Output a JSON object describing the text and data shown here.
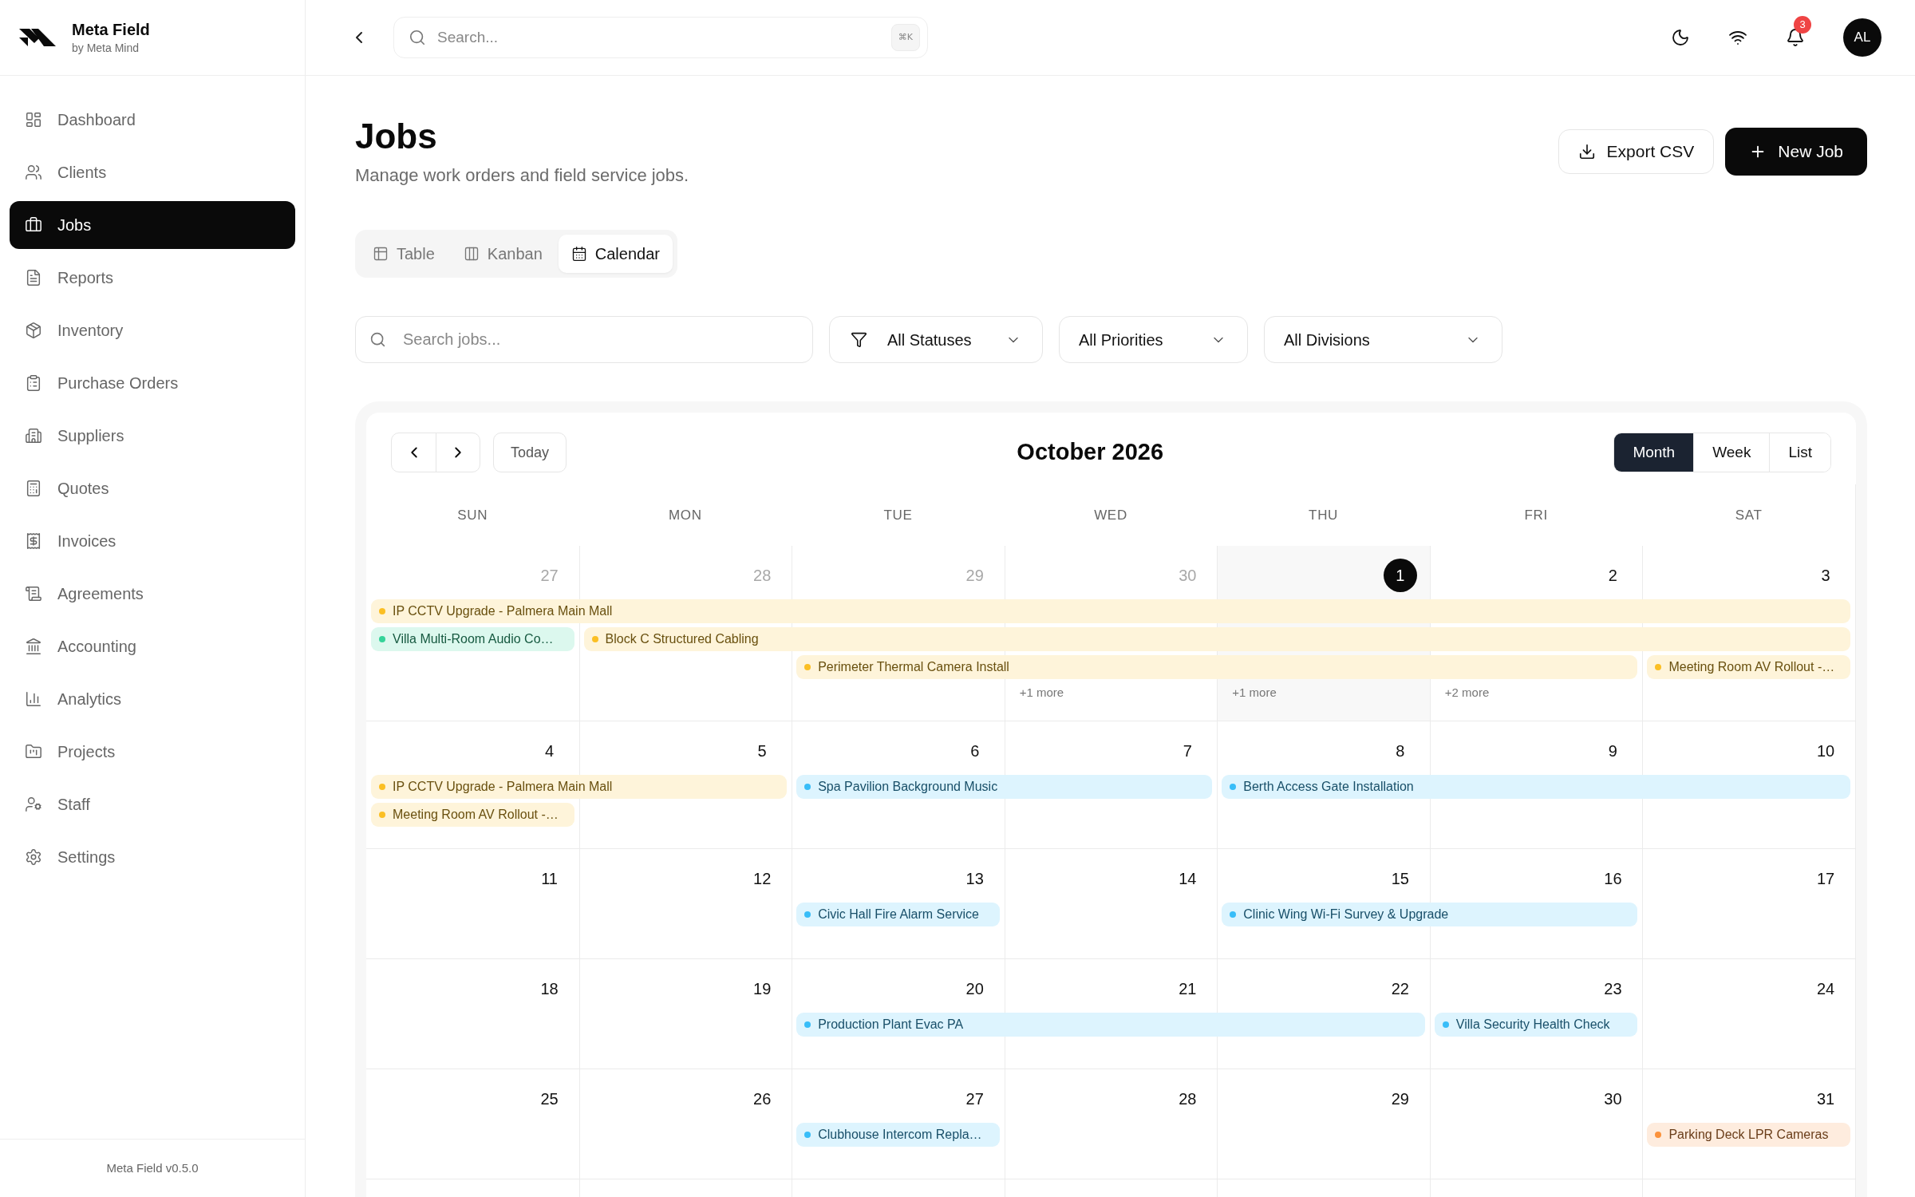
{
  "sidebar": {
    "brand": {
      "name": "Meta Field",
      "tagline": "by Meta Mind"
    },
    "items": [
      {
        "label": "Dashboard",
        "selected": false
      },
      {
        "label": "Clients",
        "selected": false
      },
      {
        "label": "Jobs",
        "selected": true
      },
      {
        "label": "Reports",
        "selected": false
      },
      {
        "label": "Inventory",
        "selected": false
      },
      {
        "label": "Purchase Orders",
        "selected": false
      },
      {
        "label": "Suppliers",
        "selected": false
      },
      {
        "label": "Quotes",
        "selected": false
      },
      {
        "label": "Invoices",
        "selected": false
      },
      {
        "label": "Agreements",
        "selected": false
      },
      {
        "label": "Accounting",
        "selected": false
      },
      {
        "label": "Analytics",
        "selected": false
      },
      {
        "label": "Projects",
        "selected": false
      },
      {
        "label": "Staff",
        "selected": false
      },
      {
        "label": "Settings",
        "selected": false
      }
    ],
    "footer": "Meta Field v0.5.0"
  },
  "topbar": {
    "search": {
      "placeholder": "Search...",
      "shortcut": "⌘K"
    },
    "notifications": {
      "count": "3"
    },
    "avatar": {
      "initials": "AL"
    }
  },
  "page": {
    "title": "Jobs",
    "subtitle": "Manage work orders and field service jobs.",
    "actions": [
      {
        "label": "Export CSV",
        "kind": "outline"
      },
      {
        "label": "New Job",
        "kind": "primary"
      }
    ]
  },
  "view_tabs": [
    {
      "label": "Table",
      "selected": false
    },
    {
      "label": "Kanban",
      "selected": false
    },
    {
      "label": "Calendar",
      "selected": true
    }
  ],
  "filters": {
    "search": {
      "placeholder": "Search jobs..."
    },
    "dropdowns": [
      {
        "value": "All Statuses",
        "kind": "filter"
      },
      {
        "value": "All Priorities",
        "kind": "select"
      },
      {
        "value": "All Divisions",
        "kind": "select"
      }
    ]
  },
  "calendar": {
    "title": "October 2026",
    "today_button": "Today",
    "views": [
      {
        "label": "Month",
        "selected": true
      },
      {
        "label": "Week",
        "selected": false
      },
      {
        "label": "List",
        "selected": false
      }
    ],
    "weekdays": [
      "SUN",
      "MON",
      "TUE",
      "WED",
      "THU",
      "FRI",
      "SAT"
    ],
    "weeks": [
      {
        "days": [
          {
            "day": "27",
            "in_month": false,
            "today": false
          },
          {
            "day": "28",
            "in_month": false,
            "today": false
          },
          {
            "day": "29",
            "in_month": false,
            "today": false
          },
          {
            "day": "30",
            "in_month": false,
            "today": false,
            "more": "+1 more"
          },
          {
            "day": "1",
            "in_month": true,
            "today": true,
            "more": "+1 more"
          },
          {
            "day": "2",
            "in_month": true,
            "today": false,
            "more": "+2 more"
          },
          {
            "day": "3",
            "in_month": true,
            "today": false
          }
        ],
        "lanes": [
          [
            {
              "kind": "event",
              "title": "IP CCTV Upgrade - Palmera Main Mall",
              "color": "#fbbf24"
            },
            {
              "kind": "continued"
            },
            {
              "kind": "continued"
            },
            {
              "kind": "continued"
            },
            {
              "kind": "continued"
            },
            {
              "kind": "continued"
            },
            {
              "kind": "continued"
            }
          ],
          [
            {
              "kind": "event",
              "title": "Villa Multi-Room Audio Co…",
              "color": "#34d399"
            },
            {
              "kind": "event",
              "title": "Block C Structured Cabling",
              "color": "#fbbf24"
            },
            {
              "kind": "continued"
            },
            {
              "kind": "continued"
            },
            {
              "kind": "continued"
            },
            {
              "kind": "continued"
            },
            {
              "kind": "continued"
            }
          ],
          [
            {
              "kind": "free"
            },
            {
              "kind": "free"
            },
            {
              "kind": "event",
              "title": "Perimeter Thermal Camera Install",
              "color": "#fbbf24"
            },
            {
              "kind": "continued"
            },
            {
              "kind": "continued"
            },
            {
              "kind": "continued"
            },
            {
              "kind": "event",
              "title": "Meeting Room AV Rollout -…",
              "color": "#fbbf24"
            }
          ]
        ]
      },
      {
        "days": [
          {
            "day": "4",
            "in_month": true,
            "today": false
          },
          {
            "day": "5",
            "in_month": true,
            "today": false
          },
          {
            "day": "6",
            "in_month": true,
            "today": false
          },
          {
            "day": "7",
            "in_month": true,
            "today": false
          },
          {
            "day": "8",
            "in_month": true,
            "today": false
          },
          {
            "day": "9",
            "in_month": true,
            "today": false
          },
          {
            "day": "10",
            "in_month": true,
            "today": false
          }
        ],
        "lanes": [
          [
            {
              "kind": "event",
              "title": "IP CCTV Upgrade - Palmera Main Mall",
              "color": "#fbbf24"
            },
            {
              "kind": "continued"
            },
            {
              "kind": "event",
              "title": "Spa Pavilion Background Music",
              "color": "#38bdf8"
            },
            {
              "kind": "continued"
            },
            {
              "kind": "event",
              "title": "Berth Access Gate Installation",
              "color": "#38bdf8"
            },
            {
              "kind": "continued"
            },
            {
              "kind": "continued"
            }
          ],
          [
            {
              "kind": "event",
              "title": "Meeting Room AV Rollout -…",
              "color": "#fbbf24"
            },
            {
              "kind": "free"
            },
            {
              "kind": "free"
            },
            {
              "kind": "free"
            },
            {
              "kind": "free"
            },
            {
              "kind": "free"
            },
            {
              "kind": "free"
            }
          ]
        ]
      },
      {
        "days": [
          {
            "day": "11",
            "in_month": true,
            "today": false
          },
          {
            "day": "12",
            "in_month": true,
            "today": false
          },
          {
            "day": "13",
            "in_month": true,
            "today": false
          },
          {
            "day": "14",
            "in_month": true,
            "today": false
          },
          {
            "day": "15",
            "in_month": true,
            "today": false
          },
          {
            "day": "16",
            "in_month": true,
            "today": false
          },
          {
            "day": "17",
            "in_month": true,
            "today": false
          }
        ],
        "lanes": [
          [
            {
              "kind": "free"
            },
            {
              "kind": "free"
            },
            {
              "kind": "event",
              "title": "Civic Hall Fire Alarm Service",
              "color": "#38bdf8"
            },
            {
              "kind": "free"
            },
            {
              "kind": "event",
              "title": "Clinic Wing Wi-Fi Survey & Upgrade",
              "color": "#38bdf8"
            },
            {
              "kind": "continued"
            },
            {
              "kind": "free"
            }
          ]
        ]
      },
      {
        "days": [
          {
            "day": "18",
            "in_month": true,
            "today": false
          },
          {
            "day": "19",
            "in_month": true,
            "today": false
          },
          {
            "day": "20",
            "in_month": true,
            "today": false
          },
          {
            "day": "21",
            "in_month": true,
            "today": false
          },
          {
            "day": "22",
            "in_month": true,
            "today": false
          },
          {
            "day": "23",
            "in_month": true,
            "today": false
          },
          {
            "day": "24",
            "in_month": true,
            "today": false
          }
        ],
        "lanes": [
          [
            {
              "kind": "free"
            },
            {
              "kind": "free"
            },
            {
              "kind": "event",
              "title": "Production Plant Evac PA",
              "color": "#38bdf8"
            },
            {
              "kind": "continued"
            },
            {
              "kind": "continued"
            },
            {
              "kind": "event",
              "title": "Villa Security Health Check",
              "color": "#38bdf8"
            },
            {
              "kind": "free"
            }
          ]
        ]
      },
      {
        "days": [
          {
            "day": "25",
            "in_month": true,
            "today": false
          },
          {
            "day": "26",
            "in_month": true,
            "today": false
          },
          {
            "day": "27",
            "in_month": true,
            "today": false
          },
          {
            "day": "28",
            "in_month": true,
            "today": false
          },
          {
            "day": "29",
            "in_month": true,
            "today": false
          },
          {
            "day": "30",
            "in_month": true,
            "today": false
          },
          {
            "day": "31",
            "in_month": true,
            "today": false
          }
        ],
        "lanes": [
          [
            {
              "kind": "free"
            },
            {
              "kind": "free"
            },
            {
              "kind": "event",
              "title": "Clubhouse Intercom Repla…",
              "color": "#38bdf8"
            },
            {
              "kind": "free"
            },
            {
              "kind": "free"
            },
            {
              "kind": "free"
            },
            {
              "kind": "event",
              "title": "Parking Deck LPR Cameras",
              "color": "#fb923c"
            }
          ]
        ]
      }
    ]
  }
}
